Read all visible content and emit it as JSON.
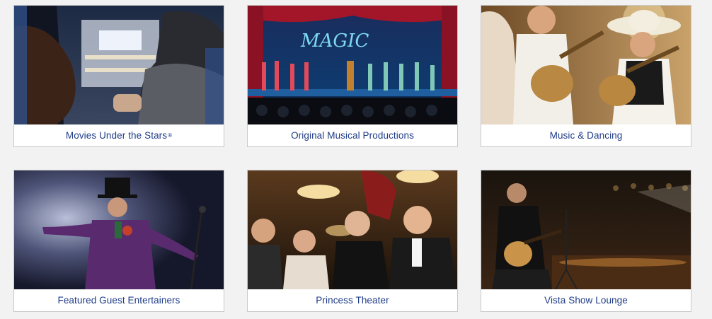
{
  "cards": [
    {
      "title": "Movies Under the Stars",
      "reg": "®",
      "image": "outdoor-movie-deck-photo"
    },
    {
      "title": "Original Musical Productions",
      "reg": "",
      "image": "stage-magic-musical-photo"
    },
    {
      "title": "Music & Dancing",
      "reg": "",
      "image": "mariachi-guitarists-photo"
    },
    {
      "title": "Featured Guest Entertainers",
      "reg": "",
      "image": "top-hat-performer-photo"
    },
    {
      "title": "Princess Theater",
      "reg": "",
      "image": "theater-audience-photo"
    },
    {
      "title": "Vista Show Lounge",
      "reg": "",
      "image": "guitarist-lounge-photo"
    }
  ],
  "stage_sign": "MAGIC",
  "colors": {
    "caption_text": "#1f3c88",
    "page_bg": "#f2f2f2",
    "card_border": "#c9c9c9"
  }
}
